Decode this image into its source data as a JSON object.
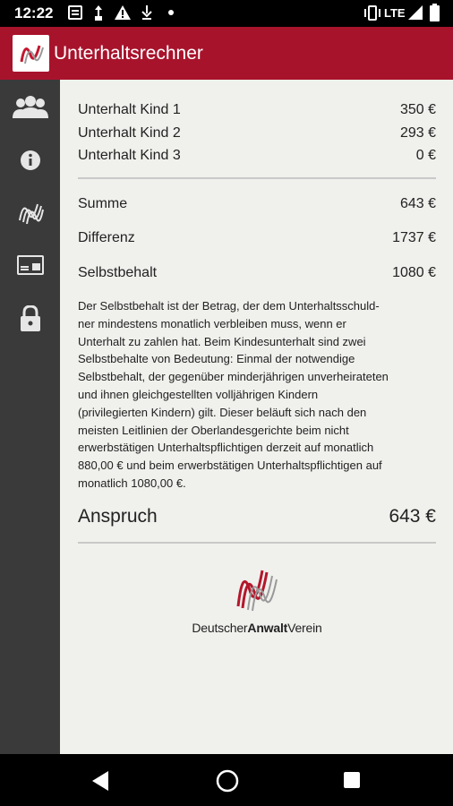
{
  "status_bar": {
    "time": "12:22",
    "network": "LTE",
    "icons": [
      "notification-icon",
      "usb-icon",
      "warning-icon",
      "download-icon",
      "dot-icon",
      "vibrate-icon",
      "signal-icon",
      "battery-icon"
    ]
  },
  "app_bar": {
    "title": "Unterhaltsrechner"
  },
  "sidebar": {
    "items": [
      {
        "icon": "group-icon"
      },
      {
        "icon": "info-icon"
      },
      {
        "icon": "wave-logo-icon"
      },
      {
        "icon": "id-card-icon"
      },
      {
        "icon": "lock-icon"
      }
    ]
  },
  "results": {
    "kind1": {
      "label": "Unterhalt Kind 1",
      "value": "350 €"
    },
    "kind2": {
      "label": "Unterhalt Kind 2",
      "value": "293 €"
    },
    "kind3": {
      "label": "Unterhalt Kind 3",
      "value": "0 €"
    },
    "summe": {
      "label": "Summe",
      "value": "643 €"
    },
    "differenz": {
      "label": "Differenz",
      "value": "1737 €"
    },
    "selbstbehalt": {
      "label": "Selbstbehalt",
      "value": "1080 €"
    },
    "anspruch": {
      "label": "Anspruch",
      "value": "643 €"
    }
  },
  "description_lines": [
    "Der Selbstbehalt ist der Betrag, der dem Unterhaltsschuld-",
    "ner mindestens monatlich verbleiben muss, wenn er",
    "Unterhalt zu zahlen hat. Beim Kindesunterhalt sind zwei",
    "Selbstbehalte von Bedeutung: Einmal der notwendige",
    "Selbstbehalt, der gegenüber minderjährigen unverheirateten",
    "und ihnen gleichgestellten volljährigen Kindern",
    "(privilegierten Kindern) gilt. Dieser beläuft sich nach den",
    "meisten Leitlinien der Oberlandesgerichte beim nicht",
    "erwerbstätigen Unterhaltspflichtigen derzeit auf monatlich",
    "880,00 € und beim erwerbstätigen Unterhaltspflichtigen auf",
    "monatlich 1080,00 €."
  ],
  "footer_logo": {
    "part1": "Deutscher",
    "part2": "Anwalt",
    "part3": "Verein"
  },
  "colors": {
    "brand_red": "#a8132c",
    "sidebar": "#3a3a3a",
    "content_bg": "#f0f0ed"
  }
}
